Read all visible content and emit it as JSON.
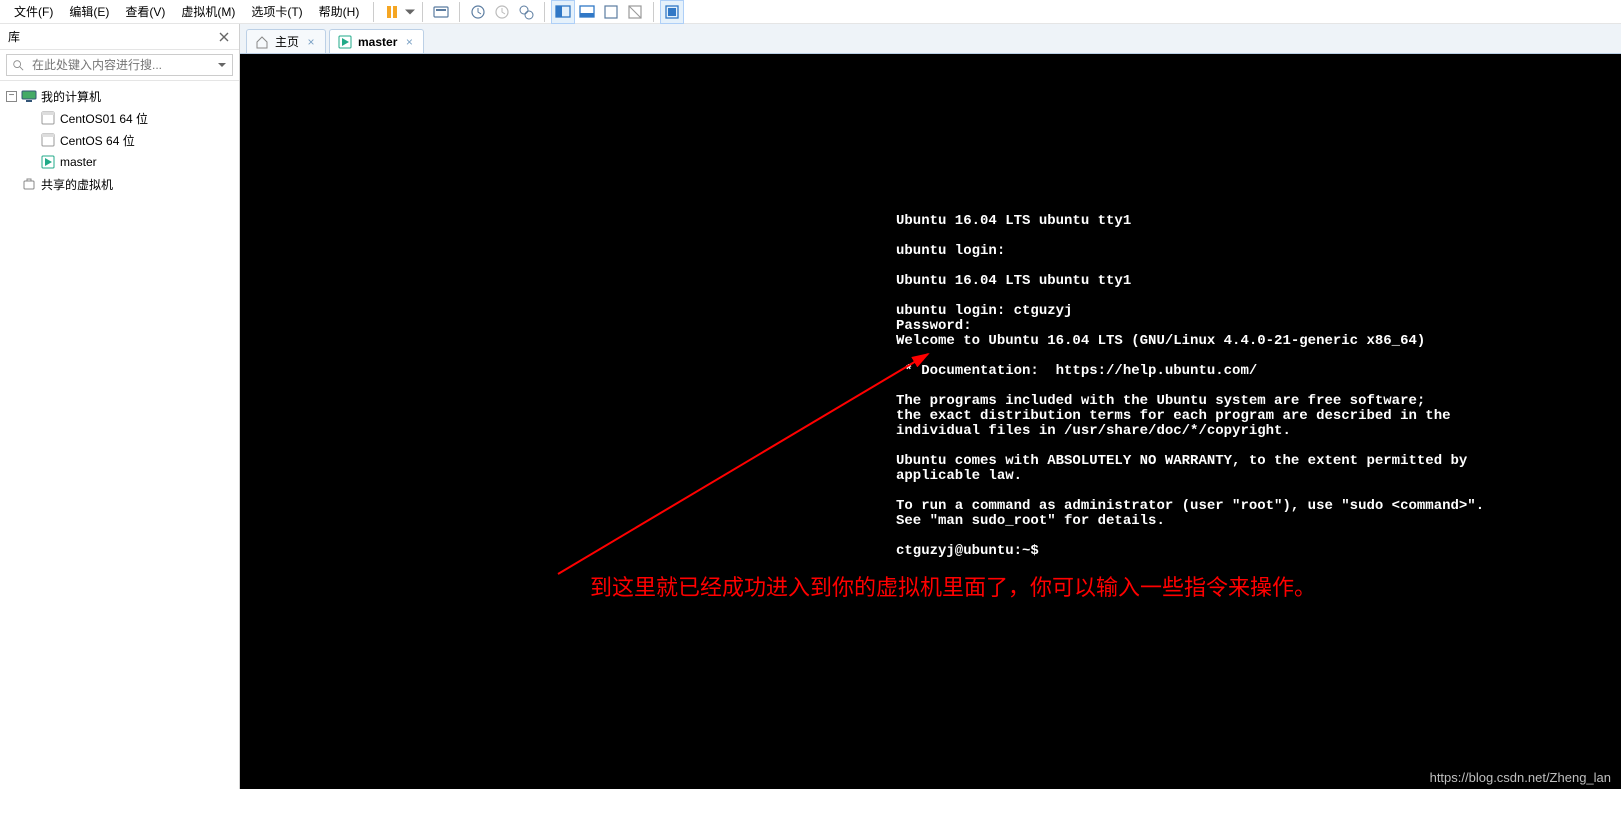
{
  "menubar": {
    "file": "文件(F)",
    "edit": "编辑(E)",
    "view": "查看(V)",
    "vm": "虚拟机(M)",
    "tabs": "选项卡(T)",
    "help": "帮助(H)"
  },
  "sidebar": {
    "title": "库",
    "search_placeholder": "在此处键入内容进行搜...",
    "root": "我的计算机",
    "children": [
      "CentOS01 64 位",
      "CentOS 64 位",
      "master"
    ],
    "shared": "共享的虚拟机"
  },
  "tabs": {
    "home": "主页",
    "vm": "master"
  },
  "terminal_lines": [
    "Ubuntu 16.04 LTS ubuntu tty1",
    "",
    "ubuntu login:",
    "",
    "Ubuntu 16.04 LTS ubuntu tty1",
    "",
    "ubuntu login: ctguzyj",
    "Password:",
    "Welcome to Ubuntu 16.04 LTS (GNU/Linux 4.4.0-21-generic x86_64)",
    "",
    " * Documentation:  https://help.ubuntu.com/",
    "",
    "The programs included with the Ubuntu system are free software;",
    "the exact distribution terms for each program are described in the",
    "individual files in /usr/share/doc/*/copyright.",
    "",
    "Ubuntu comes with ABSOLUTELY NO WARRANTY, to the extent permitted by",
    "applicable law.",
    "",
    "To run a command as administrator (user \"root\"), use \"sudo <command>\".",
    "See \"man sudo_root\" for details.",
    "",
    "ctguzyj@ubuntu:~$"
  ],
  "annotation": "到这里就已经成功进入到你的虚拟机里面了，你可以输入一些指令来操作。",
  "watermark": "https://blog.csdn.net/Zheng_lan"
}
